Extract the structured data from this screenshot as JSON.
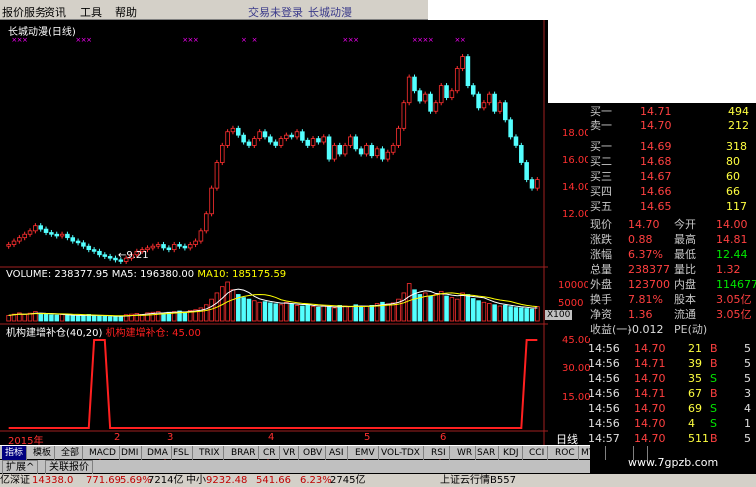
{
  "menu": {
    "items": [
      "报价服务",
      "资讯",
      "工具",
      "帮助"
    ],
    "trade_status": "交易未登录",
    "window_title": "长城动漫"
  },
  "chart": {
    "title": "长城动漫(日线)",
    "low_annotation": "9.21",
    "volume_label": "VOLUME: 238377.95",
    "ma5_label": "MA5: 196380.00",
    "ma10_label": "MA10: 185175.59",
    "vol_unit": "X100",
    "indicator_label": "机构建增补仓(40,20)",
    "indicator_value": "机构建增补仓: 45.00",
    "period": "日线",
    "year_label": "2015年",
    "month_labels": [
      "2",
      "3",
      "4",
      "5",
      "6"
    ],
    "price_ticks": [
      "18.00",
      "16.00",
      "14.00",
      "12.00"
    ],
    "vol_ticks": [
      "10000",
      "5000"
    ],
    "ind_ticks": [
      "45.00",
      "30.00",
      "15.00"
    ],
    "colors": {
      "up": "#ff3030",
      "down": "#54ffff",
      "ma5": "#ffffff",
      "ma10": "#ffff00",
      "ind": "#ff2020"
    }
  },
  "chart_data": {
    "type": "candlestick",
    "title": "长城动漫(日线)",
    "ylim": [
      9,
      21
    ],
    "close": [
      10.2,
      10.4,
      10.6,
      10.8,
      11.0,
      11.3,
      11.1,
      10.9,
      10.8,
      10.7,
      10.8,
      10.6,
      10.4,
      10.3,
      10.1,
      9.9,
      9.8,
      9.6,
      9.5,
      9.4,
      9.3,
      9.21,
      9.4,
      9.6,
      9.8,
      9.9,
      10.0,
      10.1,
      10.2,
      10.0,
      9.9,
      10.2,
      10.1,
      10.0,
      10.2,
      10.4,
      11.0,
      12.0,
      13.5,
      15.0,
      16.0,
      16.8,
      17.0,
      16.6,
      16.2,
      16.0,
      16.4,
      16.8,
      16.5,
      16.2,
      16.0,
      16.4,
      16.6,
      16.5,
      16.8,
      16.3,
      16.0,
      16.4,
      16.2,
      16.5,
      15.2,
      16.0,
      15.5,
      16.0,
      16.5,
      15.8,
      15.5,
      16.0,
      15.4,
      15.8,
      15.2,
      15.6,
      16.0,
      17.0,
      18.5,
      20.0,
      19.2,
      18.6,
      19.0,
      18.0,
      18.5,
      19.5,
      18.8,
      19.2,
      20.5,
      21.2,
      19.5,
      19.0,
      18.2,
      18.5,
      19.0,
      18.0,
      18.5,
      17.5,
      16.5,
      16.0,
      15.0,
      14.0,
      13.5,
      14.0
    ],
    "volume": [
      1800,
      2200,
      2600,
      2100,
      2500,
      3000,
      2400,
      2200,
      2000,
      1900,
      2100,
      1800,
      1700,
      1600,
      1900,
      2100,
      1800,
      1600,
      1500,
      1400,
      1500,
      1600,
      2000,
      2200,
      2400,
      2100,
      2600,
      2800,
      3000,
      2500,
      2800,
      3000,
      3200,
      2900,
      3400,
      3600,
      4200,
      5200,
      7000,
      9000,
      11000,
      12500,
      10000,
      8500,
      7500,
      7000,
      6500,
      6000,
      6200,
      5800,
      5500,
      5200,
      6000,
      5500,
      5000,
      4800,
      5200,
      4600,
      4400,
      4800,
      4500,
      4200,
      5000,
      4800,
      4600,
      5200,
      4400,
      4800,
      5000,
      5600,
      6000,
      5500,
      5800,
      7000,
      9000,
      12000,
      10000,
      8500,
      9000,
      8000,
      8500,
      9500,
      8000,
      7500,
      7000,
      9000,
      8500,
      7200,
      6500,
      6000,
      5600,
      5200,
      4800,
      5000,
      4600,
      4300,
      4200,
      4000,
      3800,
      4600
    ],
    "volume_scale": "X100",
    "indicator": [
      0,
      0,
      0,
      0,
      0,
      0,
      0,
      0,
      0,
      0,
      0,
      0,
      0,
      0,
      0,
      0,
      45,
      45,
      45,
      0,
      0,
      0,
      0,
      0,
      0,
      0,
      0,
      0,
      0,
      0,
      0,
      0,
      0,
      0,
      0,
      0,
      0,
      0,
      0,
      0,
      0,
      0,
      0,
      0,
      0,
      0,
      0,
      0,
      0,
      0,
      0,
      0,
      0,
      0,
      0,
      0,
      0,
      0,
      0,
      0,
      0,
      0,
      0,
      0,
      0,
      0,
      0,
      0,
      0,
      0,
      0,
      0,
      0,
      0,
      0,
      0,
      0,
      0,
      0,
      0,
      0,
      0,
      0,
      0,
      0,
      0,
      0,
      0,
      0,
      0,
      0,
      0,
      0,
      0,
      0,
      0,
      0,
      45,
      45,
      45
    ],
    "signal_days": [
      1,
      2,
      3,
      13,
      14,
      15,
      33,
      34,
      35,
      44,
      46,
      63,
      64,
      65,
      76,
      77,
      78,
      79,
      84,
      85
    ]
  },
  "quotes": {
    "ask_top": [
      {
        "label": "买一",
        "price": "14.71",
        "vol": "494"
      },
      {
        "label": "卖一",
        "price": "14.70",
        "vol": "212"
      }
    ],
    "levels": [
      {
        "label": "买一",
        "price": "14.69",
        "vol": "318"
      },
      {
        "label": "买二",
        "price": "14.68",
        "vol": "80"
      },
      {
        "label": "买三",
        "price": "14.67",
        "vol": "60"
      },
      {
        "label": "买四",
        "price": "14.66",
        "vol": "66"
      },
      {
        "label": "买五",
        "price": "14.65",
        "vol": "117"
      }
    ],
    "stats": [
      {
        "l1": "现价",
        "v1": "14.70",
        "l2": "今开",
        "v2": "14.00"
      },
      {
        "l1": "涨跌",
        "v1": "0.88",
        "l2": "最高",
        "v2": "14.81"
      },
      {
        "l1": "涨幅",
        "v1": "6.37%",
        "l2": "最低",
        "v2": "12.44"
      },
      {
        "l1": "总量",
        "v1": "238377",
        "l2": "量比",
        "v2": "1.32"
      },
      {
        "l1": "外盘",
        "v1": "123700",
        "l2": "内盘",
        "v2": "114677"
      },
      {
        "l1": "换手",
        "v1": "7.81%",
        "l2": "股本",
        "v2": "3.05亿"
      },
      {
        "l1": "净资",
        "v1": "1.36",
        "l2": "流通",
        "v2": "3.05亿"
      },
      {
        "l1": "收益(一)",
        "v1": "-0.012",
        "l2": "PE(动)",
        "v2": ""
      }
    ]
  },
  "ticks": [
    {
      "time": "14:56",
      "price": "14.70",
      "vol": "21",
      "dir": "B",
      "n": "5"
    },
    {
      "time": "14:56",
      "price": "14.71",
      "vol": "39",
      "dir": "B",
      "n": "5"
    },
    {
      "time": "14:56",
      "price": "14.70",
      "vol": "35",
      "dir": "S",
      "n": "5"
    },
    {
      "time": "14:56",
      "price": "14.71",
      "vol": "67",
      "dir": "B",
      "n": "3"
    },
    {
      "time": "14:56",
      "price": "14.70",
      "vol": "69",
      "dir": "S",
      "n": "4"
    },
    {
      "time": "14:56",
      "price": "14.70",
      "vol": "4",
      "dir": "S",
      "n": "1"
    },
    {
      "time": "14:57",
      "price": "14.70",
      "vol": "511",
      "dir": "B",
      "n": "5"
    }
  ],
  "toolbar": {
    "tabs": [
      "指标",
      "模板",
      "全部",
      "MACD",
      "DMI",
      "DMA",
      "FSL",
      "TRIX",
      "BRAR",
      "CR",
      "VR",
      "OBV",
      "ASI",
      "EMV",
      "VOL-TDX",
      "RSI",
      "WR",
      "SAR",
      "KDJ",
      "CCI",
      "ROC",
      "MTM",
      "BOLL",
      "▸"
    ],
    "subtabs": [
      "扩展^",
      "关联报价"
    ]
  },
  "status": {
    "items": [
      "亿",
      "深证",
      "14338.0",
      "771.69",
      "5.69%",
      "7214亿",
      "中小",
      "9232.48",
      "541.66",
      "6.23%",
      "2745亿",
      "上证云行情B557"
    ]
  },
  "watermark": "www.7gpzb.com"
}
